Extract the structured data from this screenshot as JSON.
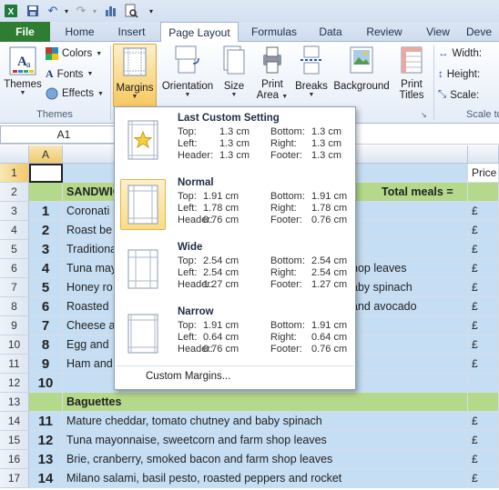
{
  "qat": {
    "undo_caret": "▾",
    "redo_caret": "▾",
    "customize": "▾"
  },
  "tabs": [
    {
      "label": "File"
    },
    {
      "label": "Home"
    },
    {
      "label": "Insert"
    },
    {
      "label": "Page Layout"
    },
    {
      "label": "Formulas"
    },
    {
      "label": "Data"
    },
    {
      "label": "Review"
    },
    {
      "label": "View"
    },
    {
      "label": "Deve"
    }
  ],
  "ribbon": {
    "themes": {
      "themes_label": "Themes",
      "colors": "Colors",
      "fonts": "Fonts",
      "effects": "Effects",
      "group": "Themes"
    },
    "page_setup": {
      "margins": "Margins",
      "orientation": "Orientation",
      "size": "Size",
      "print_area_1": "Print",
      "print_area_2": "Area",
      "breaks": "Breaks",
      "background": "Background",
      "print_titles_1": "Print",
      "print_titles_2": "Titles"
    },
    "scale": {
      "width": "Width:",
      "height": "Height:",
      "scale": "Scale:",
      "group": "Scale to"
    }
  },
  "name_box": "A1",
  "columns": [
    "A"
  ],
  "rows": [
    {
      "n": "1",
      "b": "",
      "c": "",
      "right": "Price"
    },
    {
      "n": "2",
      "b": "",
      "c": "SANDWIC",
      "c2": "Total meals =",
      "right": ""
    },
    {
      "n": "3",
      "b": "1",
      "c": "Coronati",
      "right": "£"
    },
    {
      "n": "4",
      "b": "2",
      "c": "Roast be",
      "right": "£"
    },
    {
      "n": "5",
      "b": "3",
      "c": "Traditiona",
      "right": "£"
    },
    {
      "n": "6",
      "b": "4",
      "c": "Tuna may",
      "c2": "hop leaves",
      "right": "£"
    },
    {
      "n": "7",
      "b": "5",
      "c": "Honey ro",
      "c2": "aby spinach",
      "right": "£"
    },
    {
      "n": "8",
      "b": "6",
      "c": "Roasted",
      "c2": "and avocado",
      "right": "£"
    },
    {
      "n": "9",
      "b": "7",
      "c": "Cheese a",
      "right": "£"
    },
    {
      "n": "10",
      "b": "8",
      "c": "Egg and",
      "right": "£"
    },
    {
      "n": "11",
      "b": "9",
      "c": "Ham and",
      "right": "£"
    },
    {
      "n": "12",
      "b": "10",
      "c": "",
      "right": ""
    },
    {
      "n": "13",
      "b": "",
      "c": "Baguettes",
      "right": ""
    },
    {
      "n": "14",
      "b": "11",
      "c": "Mature cheddar, tomato chutney and baby spinach",
      "right": "£"
    },
    {
      "n": "15",
      "b": "12",
      "c": "Tuna mayonnaise, sweetcorn and farm shop leaves",
      "right": "£"
    },
    {
      "n": "16",
      "b": "13",
      "c": "Brie, cranberry, smoked bacon and farm shop leaves",
      "right": "£"
    },
    {
      "n": "17",
      "b": "14",
      "c": "Milano salami, basil pesto, roasted peppers and rocket",
      "right": "£"
    }
  ],
  "margins_menu": {
    "items": [
      {
        "title": "Last Custom Setting",
        "top": "1.3 cm",
        "bottom": "1.3 cm",
        "left": "1.3 cm",
        "right": "1.3 cm",
        "header": "1.3 cm",
        "footer": "1.3 cm"
      },
      {
        "title": "Normal",
        "top": "1.91 cm",
        "bottom": "1.91 cm",
        "left": "1.78 cm",
        "right": "1.78 cm",
        "header": "0.76 cm",
        "footer": "0.76 cm"
      },
      {
        "title": "Wide",
        "top": "2.54 cm",
        "bottom": "2.54 cm",
        "left": "2.54 cm",
        "right": "2.54 cm",
        "header": "1.27 cm",
        "footer": "1.27 cm"
      },
      {
        "title": "Narrow",
        "top": "1.91 cm",
        "bottom": "1.91 cm",
        "left": "0.64 cm",
        "right": "0.64 cm",
        "header": "0.76 cm",
        "footer": "0.76 cm"
      }
    ],
    "labels": {
      "top": "Top:",
      "bottom": "Bottom:",
      "left": "Left:",
      "right": "Right:",
      "header": "Header:",
      "footer": "Footer:"
    },
    "custom": "Custom Margins..."
  },
  "colors": {
    "light_blue": "#c6def3",
    "green": "#b4d98a",
    "file_green": "#2f7d32",
    "accent": "#f4c25a"
  }
}
